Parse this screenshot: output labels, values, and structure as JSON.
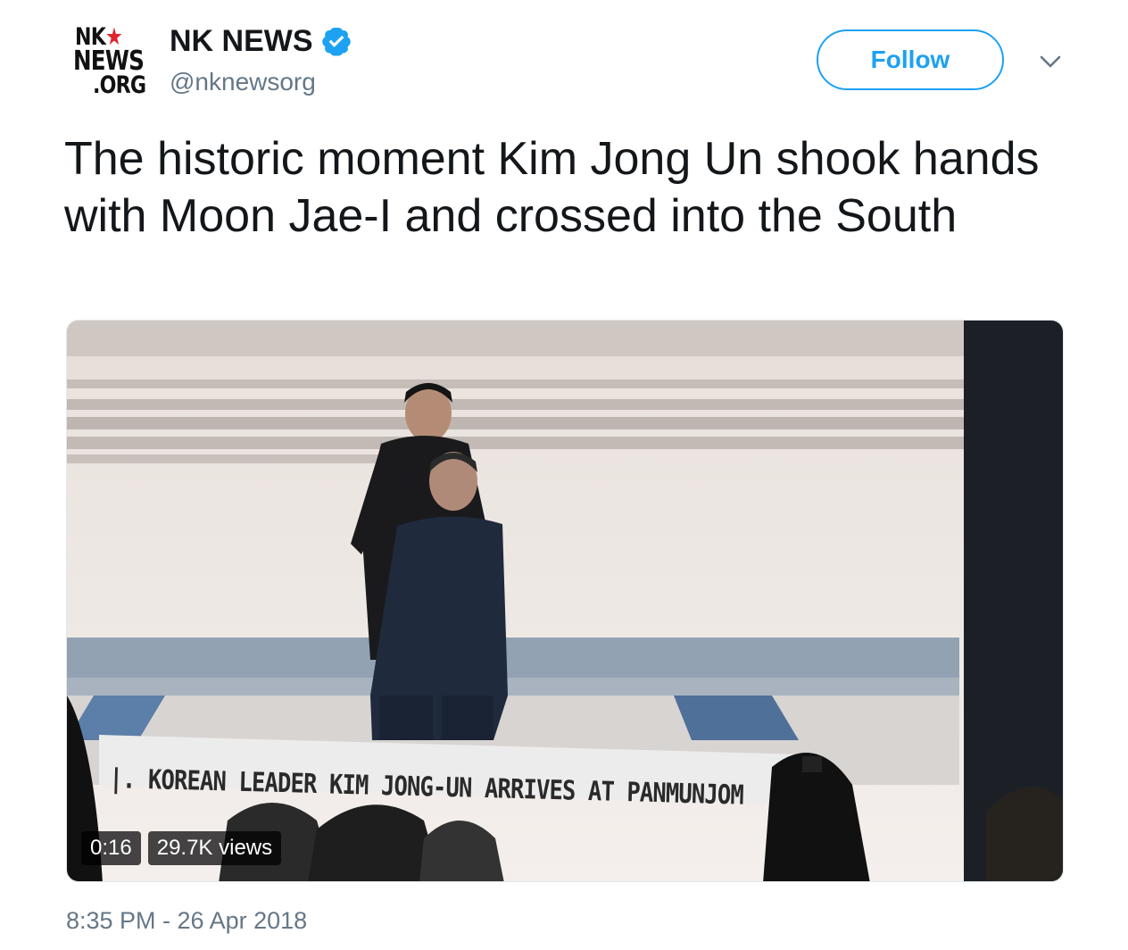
{
  "account": {
    "logo_line1": "NK",
    "logo_line2": "NEWS",
    "logo_line3": ".ORG",
    "display_name": "NK NEWS",
    "handle": "@nknewsorg",
    "verified_icon": "verified-badge-icon"
  },
  "actions": {
    "follow_label": "Follow",
    "menu_icon": "chevron-down-icon"
  },
  "tweet": {
    "text": "The historic moment Kim Jong Un shook hands with Moon Jae-I and crossed into the South",
    "timestamp": "8:35 PM - 26 Apr 2018"
  },
  "video": {
    "caption": "|. KOREAN LEADER KIM JONG-UN ARRIVES AT PANMUNJOM",
    "duration": "0:16",
    "views": "29.7K views"
  },
  "colors": {
    "accent": "#1da1f2",
    "text": "#14171a",
    "secondary": "#657786",
    "logo_red": "#e0242b"
  }
}
